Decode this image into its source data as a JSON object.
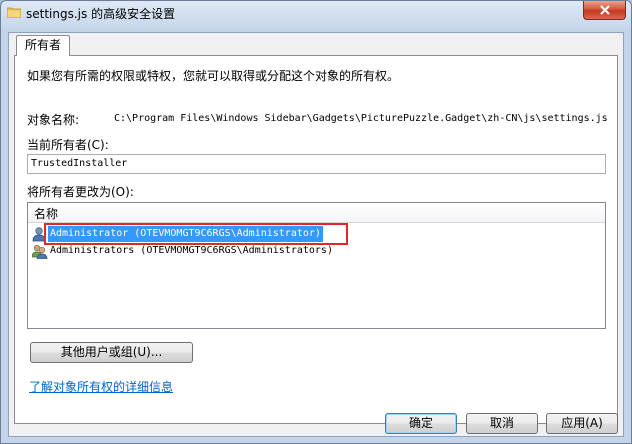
{
  "window": {
    "title": "settings.js 的高级安全设置"
  },
  "tab": {
    "label": "所有者"
  },
  "description": "如果您有所需的权限或特权，您就可以取得或分配这个对象的所有权。",
  "object_name": {
    "label": "对象名称:",
    "value": "C:\\Program Files\\Windows Sidebar\\Gadgets\\PicturePuzzle.Gadget\\zh-CN\\js\\settings.js"
  },
  "current_owner": {
    "label": "当前所有者(C):",
    "value": "TrustedInstaller"
  },
  "change_owner": {
    "label": "将所有者更改为(O):",
    "column_header": "名称",
    "items": [
      {
        "label": "Administrator (OTEVMOMGT9C6RGS\\Administrator)",
        "icon": "user-icon",
        "selected": true
      },
      {
        "label": "Administrators (OTEVMOMGT9C6RGS\\Administrators)",
        "icon": "group-icon",
        "selected": false
      }
    ]
  },
  "other_users_button": "其他用户或组(U)...",
  "learn_more_link": "了解对象所有权的详细信息",
  "buttons": {
    "ok": "确定",
    "cancel": "取消",
    "apply": "应用(A)"
  },
  "colors": {
    "selection": "#3399ff",
    "highlight_border": "#e0272a",
    "link": "#0066cc"
  }
}
